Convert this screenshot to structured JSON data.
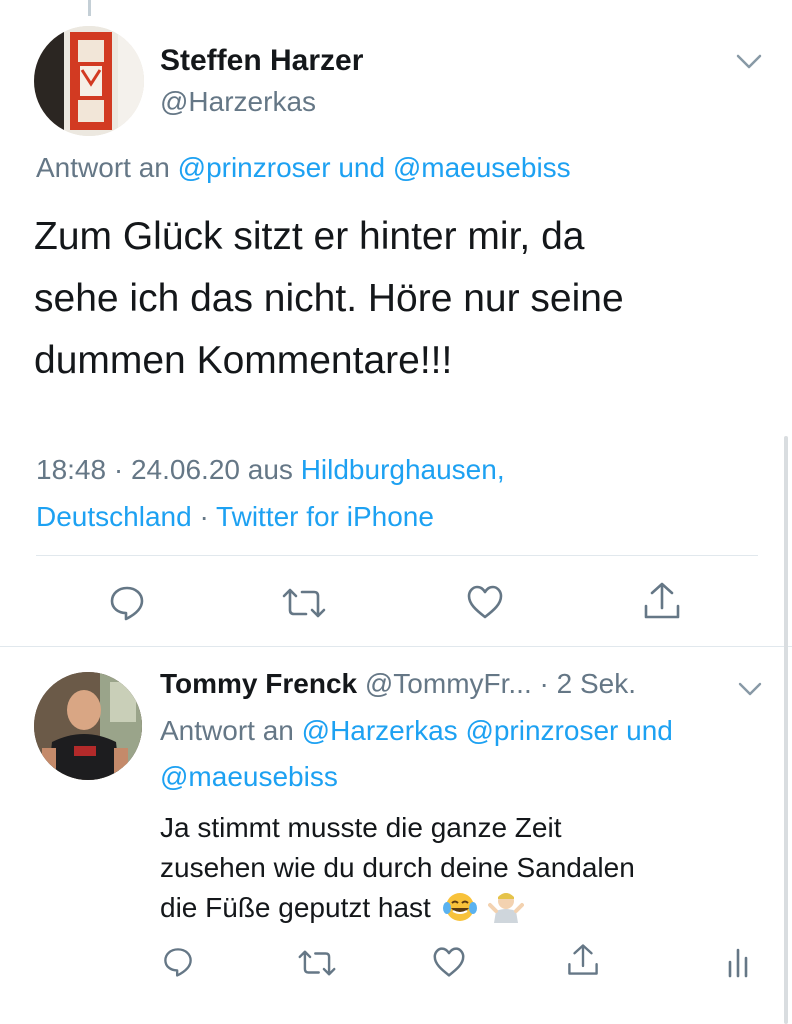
{
  "tweet1": {
    "author_name": "Steffen Harzer",
    "author_handle": "@Harzerkas",
    "reply_prefix": "Antwort an",
    "reply_user1": "@prinzroser",
    "reply_conj": "und",
    "reply_user2": "@maeusebiss",
    "text_line1": "Zum Glück sitzt er hinter mir, da",
    "text_line2": "sehe ich das nicht. Höre nur seine",
    "text_line3": "dummen Kommentare!!!",
    "time": "18:48",
    "date": "24.06.20",
    "location_prefix": "aus",
    "location_line1": "Hildburghausen,",
    "location_line2": "Deutschland",
    "client": "Twitter for iPhone",
    "separator": "·"
  },
  "tweet2": {
    "author_name": "Tommy Frenck",
    "author_handle": "@TommyFr...",
    "time_ago": "· 2 Sek.",
    "reply_prefix": "Antwort an",
    "reply_user1": "@Harzerkas",
    "reply_user2": "@prinzroser",
    "reply_conj": "und",
    "reply_user3": "@maeusebiss",
    "text_line1": "Ja stimmt musste die ganze Zeit",
    "text_line2": "zusehen wie du durch deine Sandalen",
    "text_line3": "die Füße geputzt hast",
    "emojis": [
      "face-with-tears-of-joy",
      "person-shrugging"
    ]
  },
  "icons": {
    "reply": "reply-icon",
    "retweet": "retweet-icon",
    "like": "like-icon",
    "share": "share-icon",
    "analytics": "analytics-icon",
    "chevron": "chevron-down-icon"
  },
  "colors": {
    "link": "#1da1f2",
    "secondary": "#657786",
    "text": "#14171a",
    "divider": "#e1e8ed"
  }
}
